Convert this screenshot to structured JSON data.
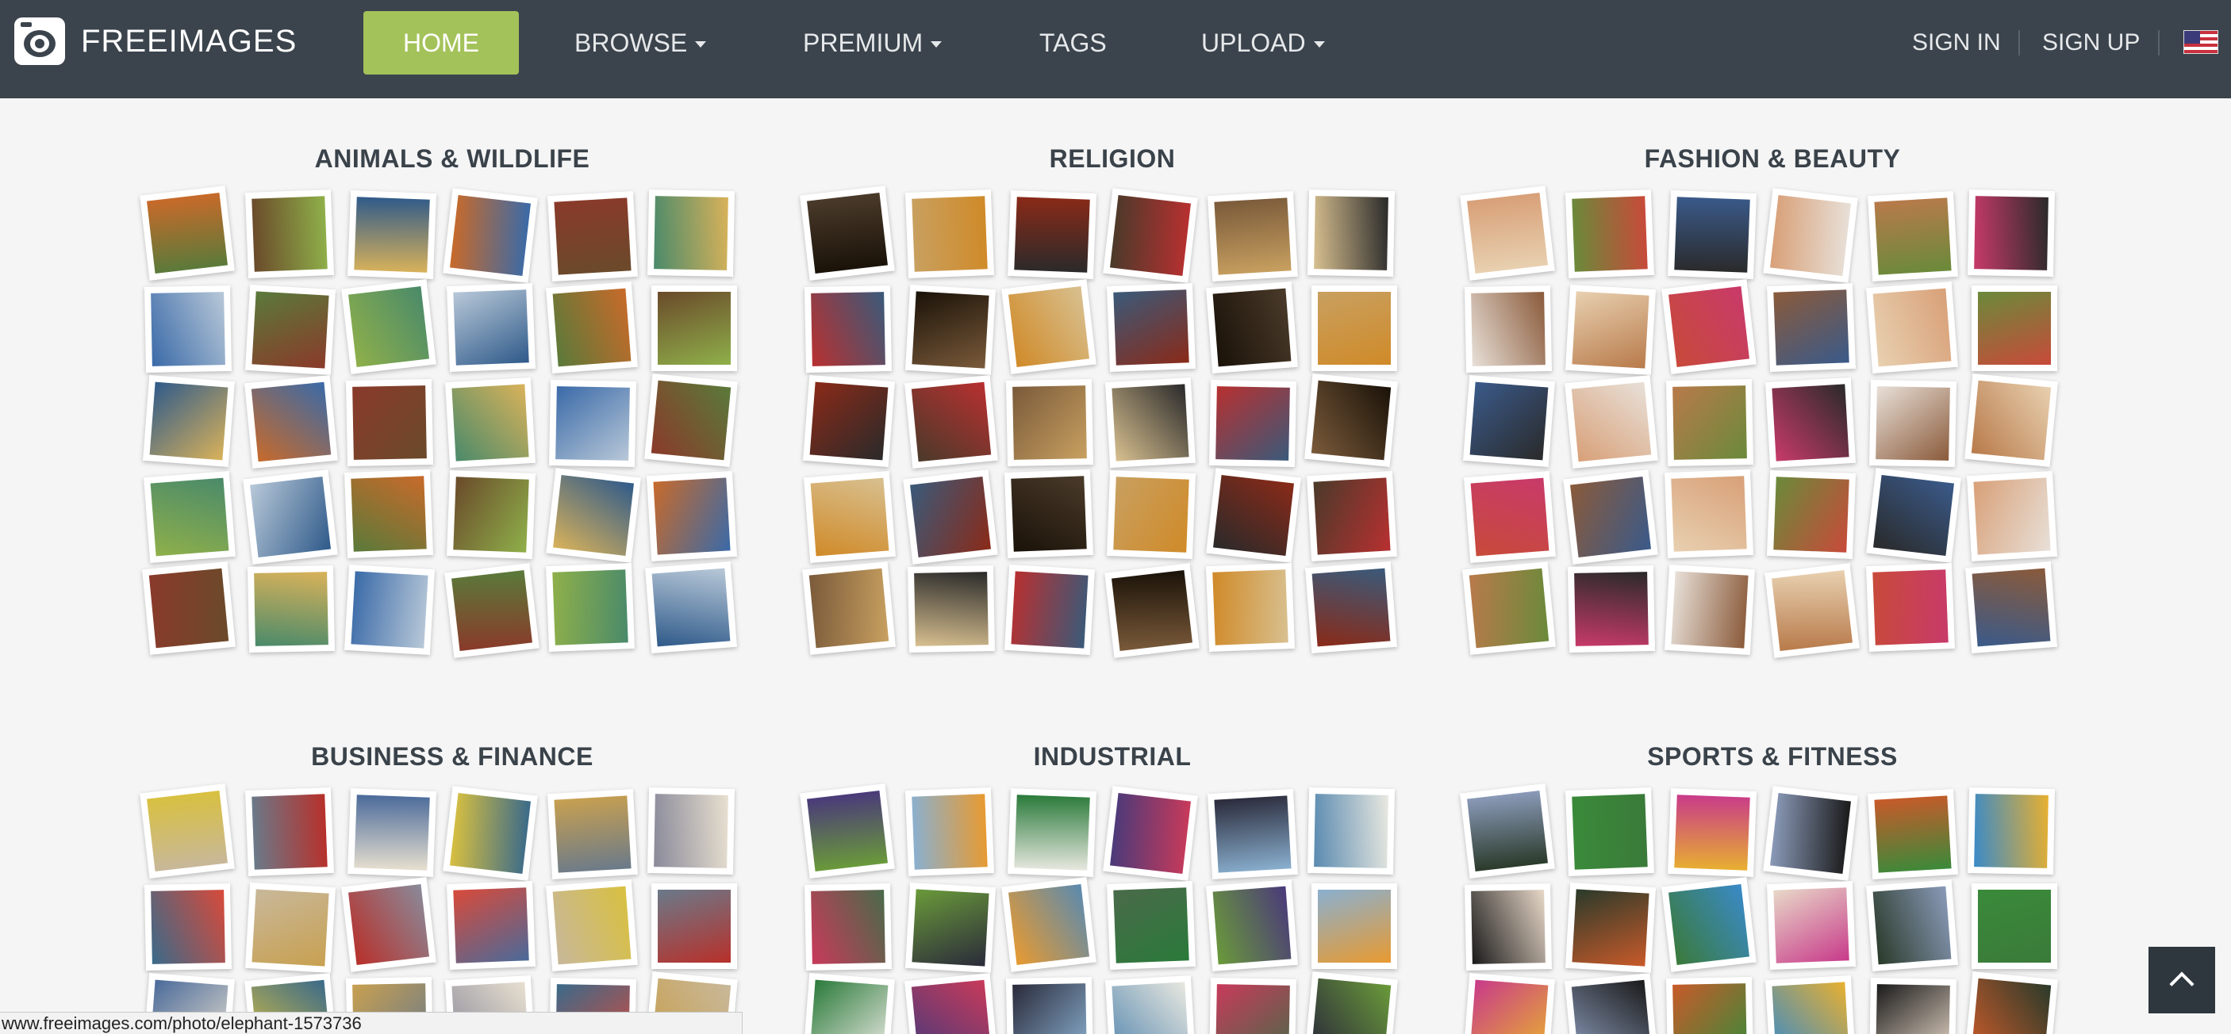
{
  "navbar": {
    "brand": "FREEIMAGES",
    "home": "HOME",
    "browse": "BROWSE",
    "premium": "PREMIUM",
    "tags": "TAGS",
    "upload": "UPLOAD",
    "sign_in": "SIGN IN",
    "sign_up": "SIGN UP",
    "language_flag": "us-flag-icon",
    "colors": {
      "background": "#3b444d",
      "active": "#a4c25a"
    }
  },
  "categories": [
    {
      "title": "ANIMALS & WILDLIFE"
    },
    {
      "title": "RELIGION"
    },
    {
      "title": "FASHION & BEAUTY"
    },
    {
      "title": "BUSINESS & FINANCE"
    },
    {
      "title": "INDUSTRIAL"
    },
    {
      "title": "SPORTS & FITNESS"
    }
  ],
  "status_bar": {
    "url": "www.freeimages.com/photo/elephant-1573736"
  },
  "back_to_top": {
    "icon": "chevron-up-icon"
  }
}
